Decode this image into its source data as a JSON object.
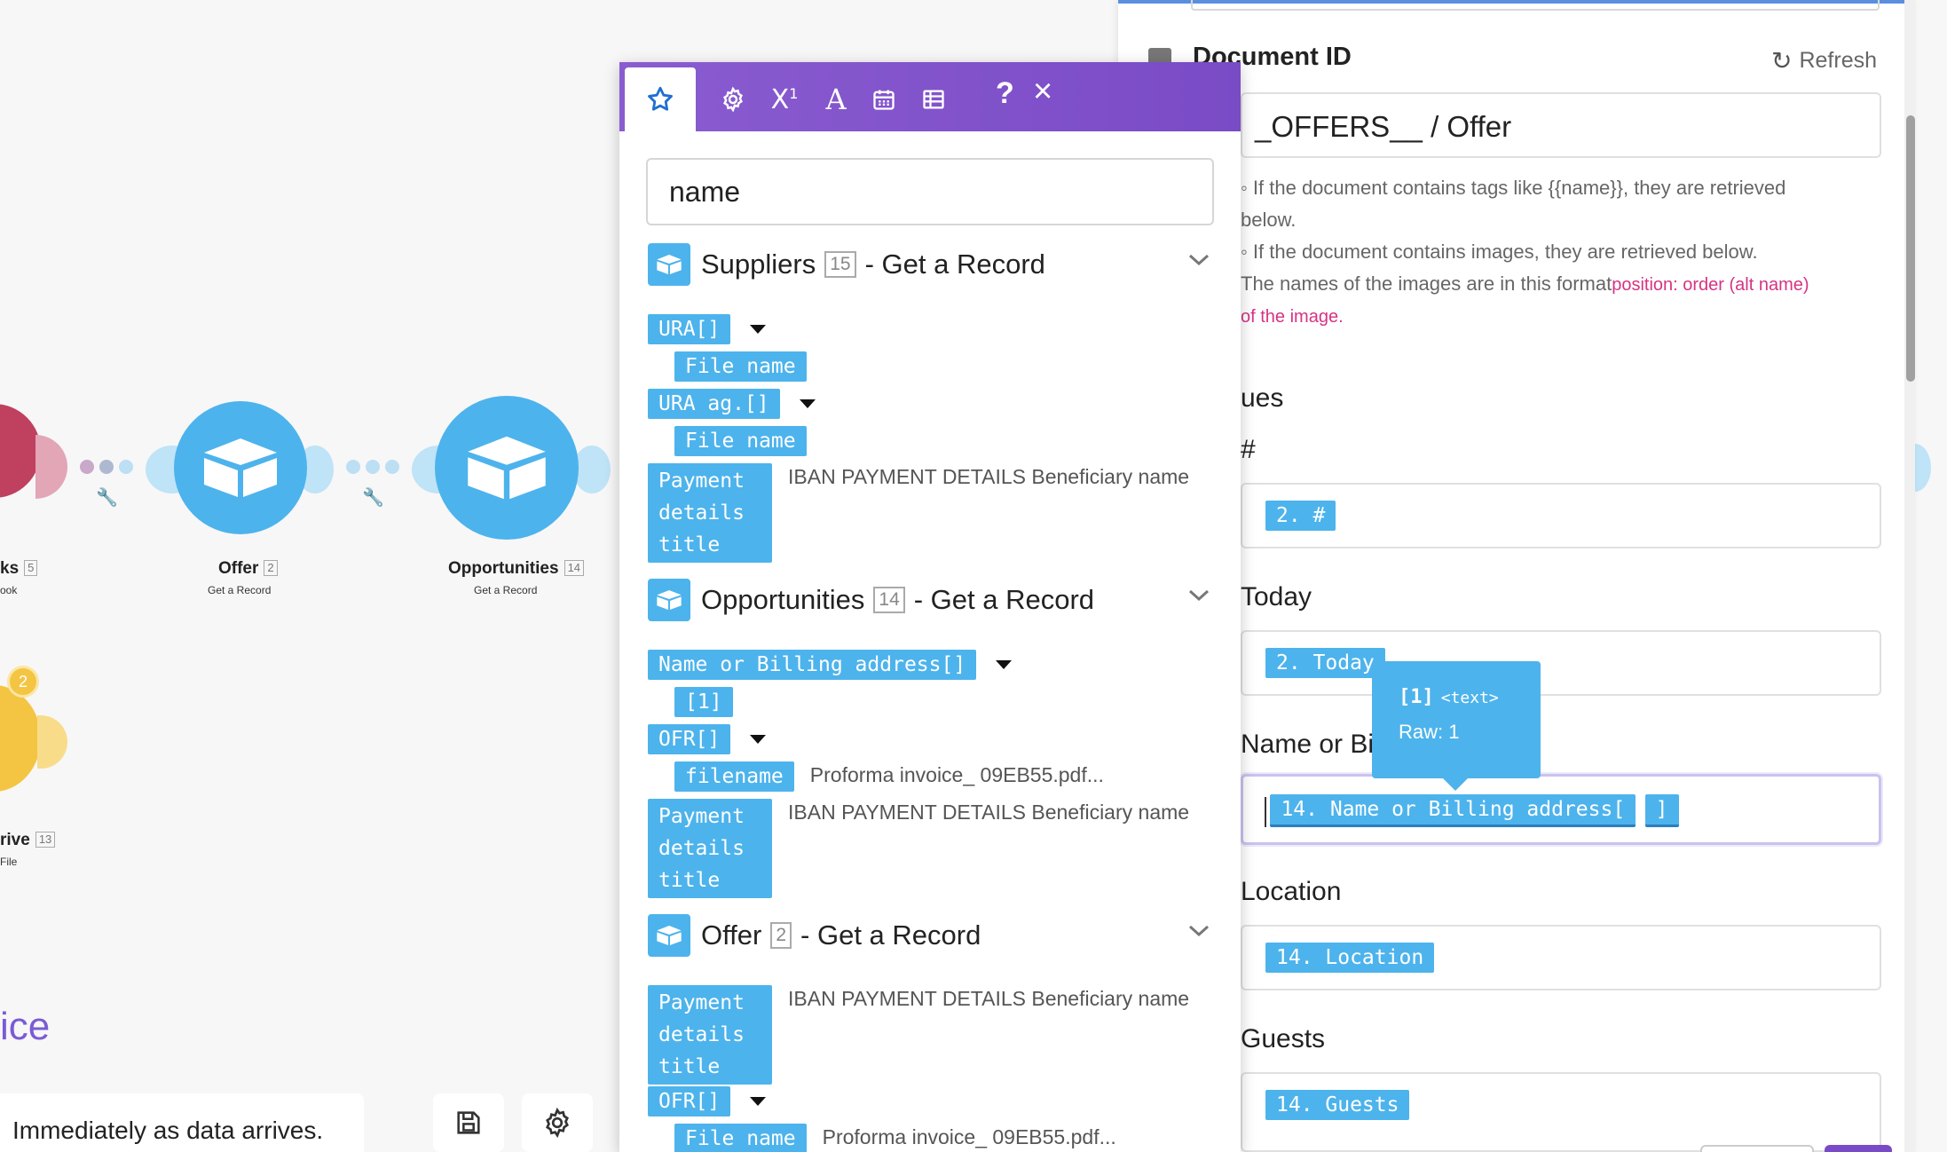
{
  "canvas": {
    "nodes": [
      {
        "label": "ks",
        "badge": "5",
        "sub": "ook"
      },
      {
        "label": "Offer",
        "badge": "2",
        "sub": "Get a Record"
      },
      {
        "label": "Opportunities",
        "badge": "14",
        "sub": "Get a Record"
      },
      {
        "label": "rive",
        "badge": "13",
        "sub": "File"
      }
    ],
    "filter_badge": "2",
    "heading": "ice",
    "schedule_text": "Immediately as data arrives."
  },
  "colors": {
    "accent_purple": "#7a4bc6",
    "pill_blue": "#4db3ec",
    "pink": "#d63384",
    "node_red": "#c0405f",
    "node_yellow": "#f4c542"
  },
  "popup": {
    "tabs": [
      "star-icon",
      "gear-icon",
      "superscript-icon",
      "text-icon",
      "calendar-icon",
      "table-icon"
    ],
    "help": "?",
    "close": "×",
    "search_value": "name",
    "groups": [
      {
        "name": "Suppliers",
        "badge": "15",
        "suffix": "- Get a Record",
        "items": [
          {
            "pill": "URA[]"
          },
          {
            "pill": "File name"
          },
          {
            "pill": "URA ag.[]"
          },
          {
            "pill": "File name"
          },
          {
            "pill": "Payment details title",
            "value": "IBAN PAYMENT DETAILS Beneficiary name"
          }
        ]
      },
      {
        "name": "Opportunities",
        "badge": "14",
        "suffix": "- Get a Record",
        "items": [
          {
            "pill": "Name or Billing address[]"
          },
          {
            "pill": "[1]"
          },
          {
            "pill": "OFR[]"
          },
          {
            "pill": "filename",
            "value": "Proforma invoice_ 09EB55.pdf..."
          },
          {
            "pill": "Payment details title",
            "value": "IBAN PAYMENT DETAILS Beneficiary name"
          }
        ]
      },
      {
        "name": "Offer",
        "badge": "2",
        "suffix": "- Get a Record",
        "items": [
          {
            "pill": "Payment details title",
            "value": "IBAN PAYMENT DETAILS Beneficiary name"
          },
          {
            "pill": "OFR[]"
          },
          {
            "pill": "File name",
            "value": "Proforma invoice_ 09EB55.pdf..."
          }
        ]
      }
    ]
  },
  "settings": {
    "doc_id_label": "Document ID",
    "refresh_label": "Refresh",
    "doc_id_value": "_OFFERS__ / Offer",
    "helper1": "If the document contains tags like {{name}}, they are retrieved below.",
    "helper1_a": "◦ If the document contains tags like {{name}}, they are retrieved",
    "helper1_b": "below.",
    "helper2": "◦ If the document contains images, they are retrieved below.",
    "helper3_a": "The names of the images are in this format",
    "helper3_pink": "position: order (alt name)",
    "helper3_b": "of the image.",
    "values_heading": "ues",
    "fields": [
      {
        "label": "#",
        "pill": "2. #"
      },
      {
        "label": "Today",
        "pill": "2. Today"
      },
      {
        "label": "Name or Bil",
        "pill": "14. Name or Billing address[",
        "pill2": "]"
      },
      {
        "label": "Location",
        "pill": "14. Location"
      },
      {
        "label": "Guests",
        "pill": "14. Guests"
      }
    ],
    "tooltip": {
      "title": "[1]",
      "type": "<text>",
      "raw": "Raw: 1"
    }
  }
}
